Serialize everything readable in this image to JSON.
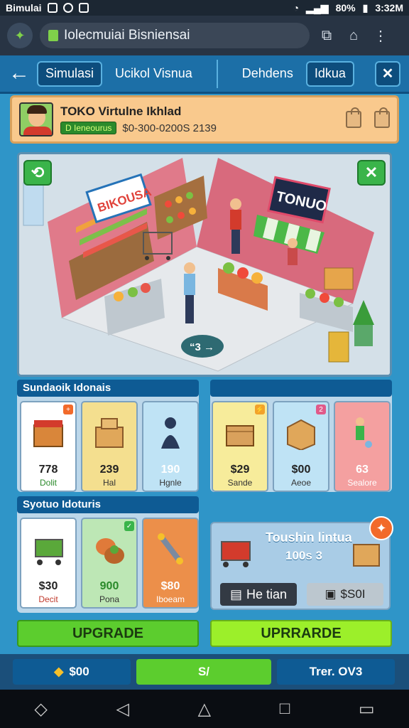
{
  "status_bar": {
    "carrier": "Bimulai",
    "battery": "80%",
    "time": "3:32M"
  },
  "browser": {
    "url": "Iolecmuiai Bisniensai"
  },
  "nav": {
    "tabs": [
      "Simulasi",
      "Ucikol Visnua",
      "Dehdens",
      "Idkua"
    ]
  },
  "store": {
    "title": "TOKO Virtulne Ikhlad",
    "tag": "D Ieneourus",
    "value": "$0-300-0200S 2139"
  },
  "scene": {
    "sign_left": "BIKOUSA",
    "sign_right": "TONUO",
    "chat_label": "“3 →"
  },
  "sections": {
    "left_top": "Sundaoik Idonais",
    "left_bottom": "Syotuo Idoturis",
    "right_top": ""
  },
  "cards_top_left": [
    {
      "price": "778",
      "caption": "Dolit",
      "bg": "#ffffff"
    },
    {
      "price": "239",
      "caption": "Hal",
      "bg": "#f4df8f"
    },
    {
      "price": "190",
      "caption": "Hgnle",
      "bg": "#bfe3f5"
    }
  ],
  "cards_top_right": [
    {
      "price": "$29",
      "caption": "Sande",
      "bg": "#f7ec9b"
    },
    {
      "price": "$00",
      "caption": "Aeoe",
      "bg": "#bfe3f5"
    },
    {
      "price": "63",
      "caption": "Sealore",
      "bg": "#f4a0a0"
    }
  ],
  "cards_bottom_left": [
    {
      "price": "$30",
      "caption": "Decit",
      "bg": "#ffffff"
    },
    {
      "price": "900",
      "caption": "Pona",
      "bg": "#bde7b5"
    },
    {
      "price": "$80",
      "caption": "Iboeam",
      "bg": "#ec8f4a"
    }
  ],
  "promo": {
    "title": "Toushin lintua",
    "sub": "100s 3",
    "btn1": "He tian",
    "btn2": "$S0I"
  },
  "buttons": {
    "upgrade_left": "UPGRADE",
    "upgrade_right": "UPRRARDE"
  },
  "bottom_stats": {
    "money": "$00",
    "mid": "S/",
    "tier": "Trer. OV3"
  }
}
